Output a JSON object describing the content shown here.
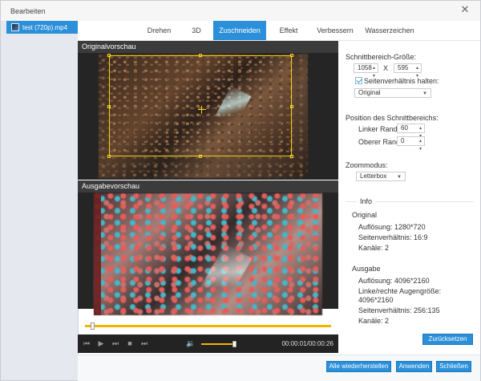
{
  "window": {
    "title": "Bearbeiten",
    "close_icon": "close-icon"
  },
  "sidebar": {
    "items": [
      {
        "label": "test (720p).mp4",
        "icon": "video-thumbnail-icon"
      }
    ]
  },
  "tabs": [
    {
      "label": "Drehen",
      "active": false
    },
    {
      "label": "3D",
      "active": false
    },
    {
      "label": "Zuschneiden",
      "active": true
    },
    {
      "label": "Effekt",
      "active": false
    },
    {
      "label": "Verbessern",
      "active": false
    },
    {
      "label": "Wasserzeichen",
      "active": false
    }
  ],
  "preview": {
    "original_label": "Originalvorschau",
    "output_label": "Ausgabevorschau"
  },
  "player": {
    "time": "00:00:01/00:00:26",
    "icons": {
      "previous": "skip-back-icon",
      "play": "play-icon",
      "forward": "fast-forward-icon",
      "stop": "stop-icon",
      "next": "skip-forward-icon",
      "volume": "volume-icon"
    }
  },
  "crop": {
    "size_label": "Schnittbereich-Größe:",
    "width": "1058",
    "separator": "X",
    "height": "595",
    "keep_ratio_label": "Seitenverhältnis halten:",
    "keep_ratio_checked": true,
    "ratio_value": "Original",
    "position_label": "Position des Schnittbereichs:",
    "left_margin_label": "Linker Rand:",
    "left_margin_value": "60",
    "top_margin_label": "Oberer Rand:",
    "top_margin_value": "0",
    "zoom_label": "Zoommodus:",
    "zoom_value": "Letterbox"
  },
  "info": {
    "title": "Info",
    "original_title": "Original",
    "original_resolution": "Auflösung: 1280*720",
    "original_ratio": "Seitenverhältnis: 16:9",
    "original_channels": "Kanäle: 2",
    "output_title": "Ausgabe",
    "output_resolution": "Auflösung: 4096*2160",
    "output_eye_label": "Linke/rechte Augengröße:",
    "output_eye_size": "4096*2160",
    "output_ratio": "Seitenverhältnis: 256:135",
    "output_channels": "Kanäle: 2"
  },
  "buttons": {
    "reset": "Zurücksetzen",
    "restore_all": "Alle wiederherstellen",
    "apply": "Anwenden",
    "close": "Schließen"
  },
  "colors": {
    "accent": "#2b90d9",
    "crop_frame": "#f2d31b",
    "progress": "#f0b400"
  },
  "progress": {
    "position_fraction": 0.038,
    "volume_fraction": 0.9
  }
}
